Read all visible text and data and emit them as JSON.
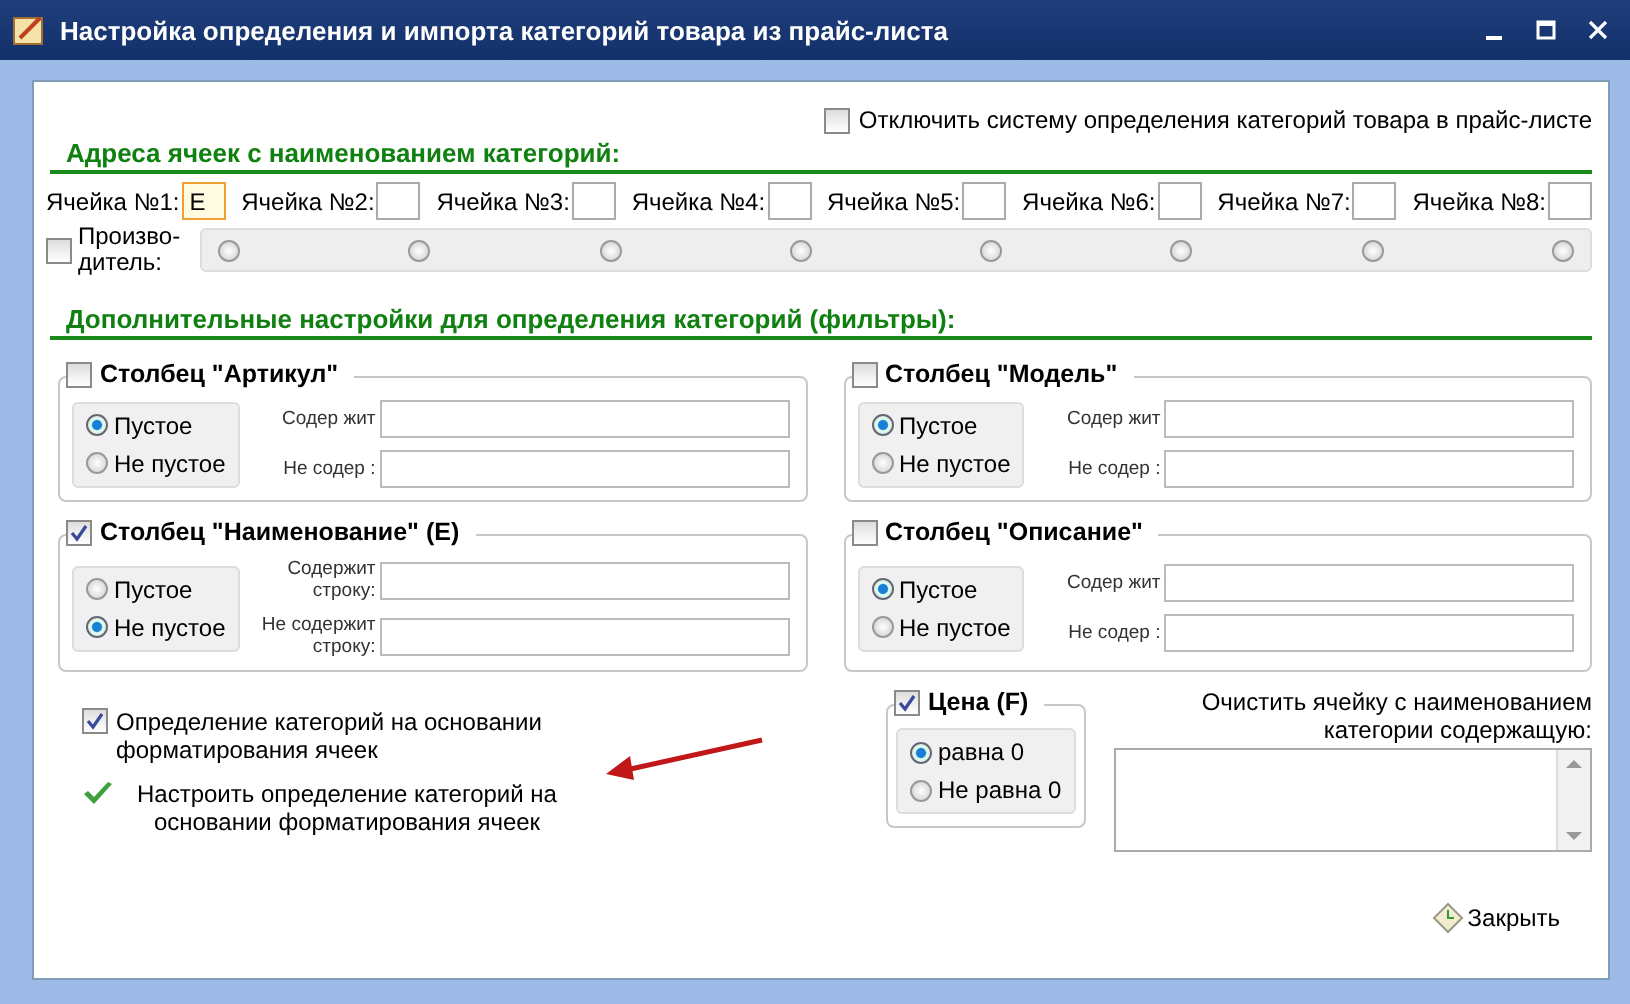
{
  "window": {
    "title": "Настройка определения и импорта категорий товара из прайс-листа"
  },
  "disable_option": {
    "label": "Отключить систему определения категорий товара в прайс-листе",
    "checked": false
  },
  "cells_section": {
    "title": "Адреса ячеек с наименованием категорий:"
  },
  "cells": [
    {
      "label": "Ячейка №1:",
      "value": "E",
      "focused": true
    },
    {
      "label": "Ячейка №2:",
      "focused": false
    },
    {
      "label": "Ячейка №3:",
      "focused": false
    },
    {
      "label": "Ячейка №4:",
      "focused": false
    },
    {
      "label": "Ячейка №5:",
      "focused": false
    },
    {
      "label": "Ячейка №6:",
      "focused": false
    },
    {
      "label": "Ячейка №7:",
      "focused": false
    },
    {
      "label": "Ячейка №8:",
      "focused": false
    }
  ],
  "manufacturer": {
    "label": "Произво-дитель:",
    "checked": false,
    "radios": [
      {
        "selected": false
      },
      {
        "selected": false
      },
      {
        "selected": false
      },
      {
        "selected": false
      },
      {
        "selected": false
      },
      {
        "selected": false
      },
      {
        "selected": false
      },
      {
        "selected": false
      }
    ]
  },
  "filters_section": {
    "title": "Дополнительные настройки для определения категорий (фильтры):"
  },
  "filters": [
    {
      "title": "Столбец \"Артикул\"",
      "checked": false,
      "options": [
        {
          "label": "Пустое",
          "selected": true
        },
        {
          "label": "Не пустое",
          "selected": false
        }
      ],
      "fields": [
        {
          "label": "Содер жит"
        },
        {
          "label": "Не содер :"
        }
      ]
    },
    {
      "title": "Столбец \"Модель\"",
      "checked": false,
      "options": [
        {
          "label": "Пустое",
          "selected": true
        },
        {
          "label": "Не пустое",
          "selected": false
        }
      ],
      "fields": [
        {
          "label": "Содер жит"
        },
        {
          "label": "Не содер :"
        }
      ]
    },
    {
      "title": "Столбец \"Наименование\" (E)",
      "checked": true,
      "options": [
        {
          "label": "Пустое",
          "selected": false
        },
        {
          "label": "Не пустое",
          "selected": true
        }
      ],
      "fields": [
        {
          "label": "Содержит строку:"
        },
        {
          "label": "Не содержит строку:"
        }
      ]
    },
    {
      "title": "Столбец \"Описание\"",
      "checked": false,
      "options": [
        {
          "label": "Пустое",
          "selected": true
        },
        {
          "label": "Не пустое",
          "selected": false
        }
      ],
      "fields": [
        {
          "label": "Содер жит"
        },
        {
          "label": "Не содер :"
        }
      ]
    }
  ],
  "format_option": {
    "label": "Определение категорий на основании форматирования ячеек",
    "checked": true
  },
  "format_link": {
    "label": "Настроить определение категорий на основании форматирования ячеек"
  },
  "price": {
    "title": "Цена (F)",
    "checked": true,
    "options": [
      {
        "label": "равна 0",
        "selected": true
      },
      {
        "label": "Не равна 0",
        "selected": false
      }
    ]
  },
  "clear_cell": {
    "label": "Очистить ячейку с наименованием категории содержащую:"
  },
  "close_button": {
    "label": "Закрыть"
  }
}
